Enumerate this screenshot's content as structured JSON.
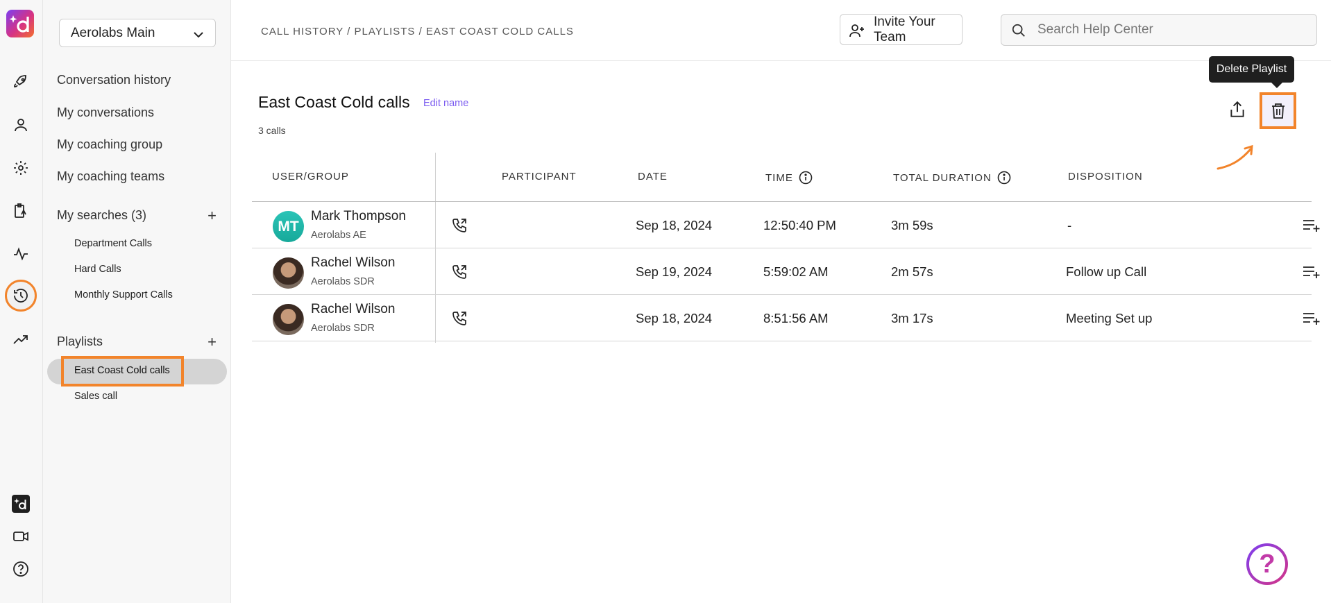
{
  "workspace": {
    "name": "Aerolabs Main"
  },
  "sidebar": {
    "nav": [
      "Conversation history",
      "My conversations",
      "My coaching group",
      "My coaching teams"
    ],
    "searches": {
      "label": "My searches (3)",
      "items": [
        "Department Calls",
        "Hard Calls",
        "Monthly Support Calls"
      ]
    },
    "playlists": {
      "label": "Playlists",
      "items": [
        "East Coast Cold calls",
        "Sales call"
      ],
      "active": "East Coast Cold calls"
    }
  },
  "header": {
    "breadcrumb": "CALL HISTORY / PLAYLISTS / EAST COAST COLD CALLS",
    "invite_label": "Invite Your Team",
    "search_placeholder": "Search Help Center"
  },
  "playlist": {
    "title": "East Coast Cold calls",
    "edit_label": "Edit name",
    "count": "3 calls",
    "delete_tooltip": "Delete Playlist"
  },
  "table": {
    "columns": [
      "USER/GROUP",
      "PARTICIPANT",
      "DATE",
      "TIME",
      "TOTAL DURATION",
      "DISPOSITION"
    ],
    "rows": [
      {
        "initials": "MT",
        "name": "Mark Thompson",
        "group": "Aerolabs AE",
        "date": "Sep 18, 2024",
        "time": "12:50:40 PM",
        "duration": "3m 59s",
        "disposition": "-"
      },
      {
        "initials": "",
        "name": "Rachel Wilson",
        "group": "Aerolabs SDR",
        "date": "Sep 19, 2024",
        "time": "5:59:02 AM",
        "duration": "2m 57s",
        "disposition": "Follow up Call"
      },
      {
        "initials": "",
        "name": "Rachel Wilson",
        "group": "Aerolabs SDR",
        "date": "Sep 18, 2024",
        "time": "8:51:56 AM",
        "duration": "3m 17s",
        "disposition": "Meeting Set up"
      }
    ]
  },
  "help": {
    "symbol": "?"
  },
  "colors": {
    "highlight": "#f2842b",
    "accent": "#7b5cf0"
  }
}
